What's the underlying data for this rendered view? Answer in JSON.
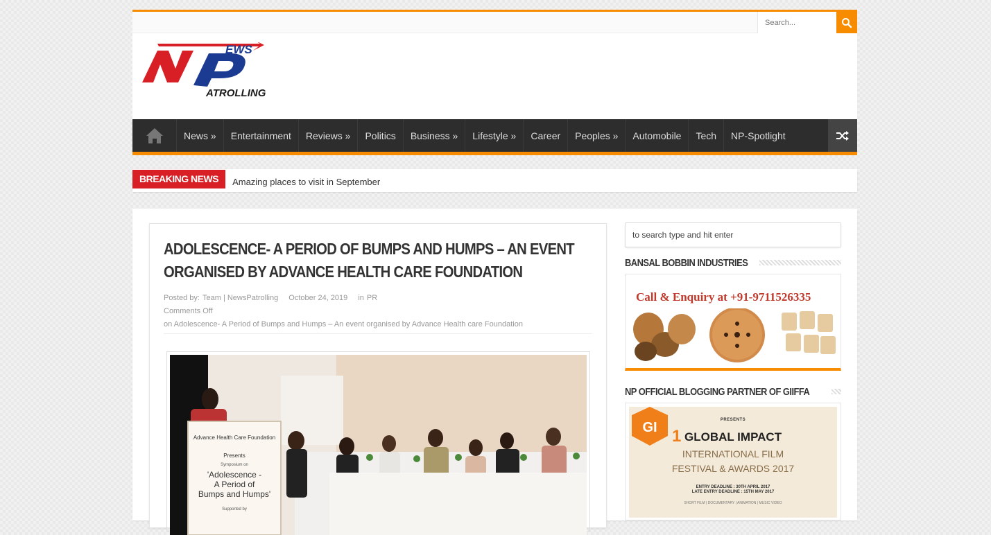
{
  "search": {
    "placeholder": "Search..."
  },
  "logo": {
    "top": "EWS",
    "bottom": "ATROLLING"
  },
  "nav": {
    "items": [
      "News »",
      "Entertainment",
      "Reviews »",
      "Politics",
      "Business »",
      "Lifestyle »",
      "Career",
      "Peoples »",
      "Automobile",
      "Tech",
      "NP-Spotlight"
    ],
    "icons": {
      "home": "home-icon",
      "random": "shuffle-icon"
    }
  },
  "breaking": {
    "label": "Breaking News",
    "headline": "Amazing places to visit in September"
  },
  "article": {
    "title": "Adolescence- A Period of Bumps and Humps – An event organised by Advance Health care Foundation",
    "posted_by_label": "Posted by:",
    "author": "Team | NewsPatrolling",
    "date": "October 24, 2019",
    "in_label": "in",
    "category": "PR",
    "comments": "Comments Off",
    "comments_on": "on Adolescence- A Period of Bumps and Humps – An event organised by Advance Health care Foundation",
    "banner_org": "Advance Health Care Foundation",
    "banner_presents": "Presents",
    "banner_symposium": "Symposium on",
    "banner_line1": "'Adolescence -",
    "banner_line2": "A Period of",
    "banner_line3": "Bumps and Humps'",
    "banner_supported": "Supported by"
  },
  "sidebar": {
    "search_placeholder": "to search type and hit enter",
    "widget1_title": "Bansal Bobbin Industries",
    "widget1_ad_text": "Call & Enquiry at +91-9711526335",
    "widget2_title": "NP Official Blogging Partner of GIIFFA",
    "widget2_presents": "PRESENTS",
    "widget2_gi": "GI",
    "widget2_number": "1",
    "widget2_title_text": "GLOBAL IMPACT",
    "widget2_line1": "INTERNATIONAL FILM",
    "widget2_line2": "FESTIVAL & AWARDS 2017",
    "widget2_deadline1": "ENTRY DEADLINE : 30TH APRIL 2017",
    "widget2_deadline2": "LATE ENTRY DEADLINE : 15TH MAY 2017",
    "widget2_categories": "SHORT FILM | DOCUMENTARY | ANIMATION | MUSIC VIDEO"
  },
  "colors": {
    "accent": "#f88c00",
    "breaking": "#d91f26",
    "nav_bg": "#2d2d2d"
  }
}
